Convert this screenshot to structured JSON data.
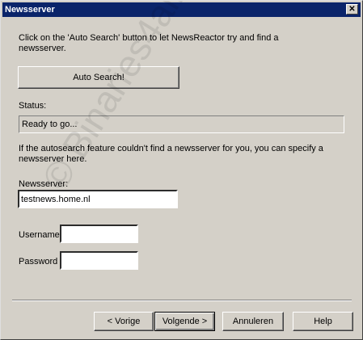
{
  "window": {
    "title": "Newsserver",
    "close_glyph": "✕"
  },
  "intro_text": "Click on the 'Auto Search' button to let NewsReactor try and find a newsserver.",
  "auto_search_button": "Auto Search!",
  "status": {
    "label": "Status:",
    "value": "Ready to go..."
  },
  "manual_text": "If the autosearch feature couldn't find a newsserver for you, you can specify a newsserver here.",
  "newsserver": {
    "label": "Newsserver:",
    "value": "testnews.home.nl"
  },
  "username": {
    "label": "Username",
    "value": ""
  },
  "password": {
    "label": "Password",
    "value": ""
  },
  "buttons": {
    "back": "< Vorige",
    "next": "Volgende >",
    "cancel": "Annuleren",
    "help": "Help"
  },
  "watermark": "© Binaries4all"
}
